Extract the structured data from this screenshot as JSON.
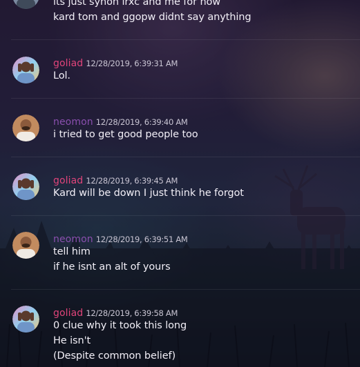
{
  "colors": {
    "goliad": "#e0447a",
    "neomon": "#8a4fae"
  },
  "top_message": {
    "lines": [
      "its just synon irxc and me for now",
      "kard tom and ggopw didnt say anything"
    ]
  },
  "messages": [
    {
      "username": "goliad",
      "timestamp": "12/28/2019, 6:39:31 AM",
      "lines": [
        "Lol."
      ]
    },
    {
      "username": "neomon",
      "timestamp": "12/28/2019, 6:39:40 AM",
      "lines": [
        "i tried to get good people too"
      ]
    },
    {
      "username": "goliad",
      "timestamp": "12/28/2019, 6:39:45 AM",
      "lines": [
        "Kard will be down I just think he forgot"
      ]
    },
    {
      "username": "neomon",
      "timestamp": "12/28/2019, 6:39:51 AM",
      "lines": [
        "tell him",
        "if he isnt an alt of yours"
      ]
    },
    {
      "username": "goliad",
      "timestamp": "12/28/2019, 6:39:58 AM",
      "lines": [
        "0 clue why it took this long",
        "He isn't",
        "(Despite common belief)"
      ]
    }
  ]
}
